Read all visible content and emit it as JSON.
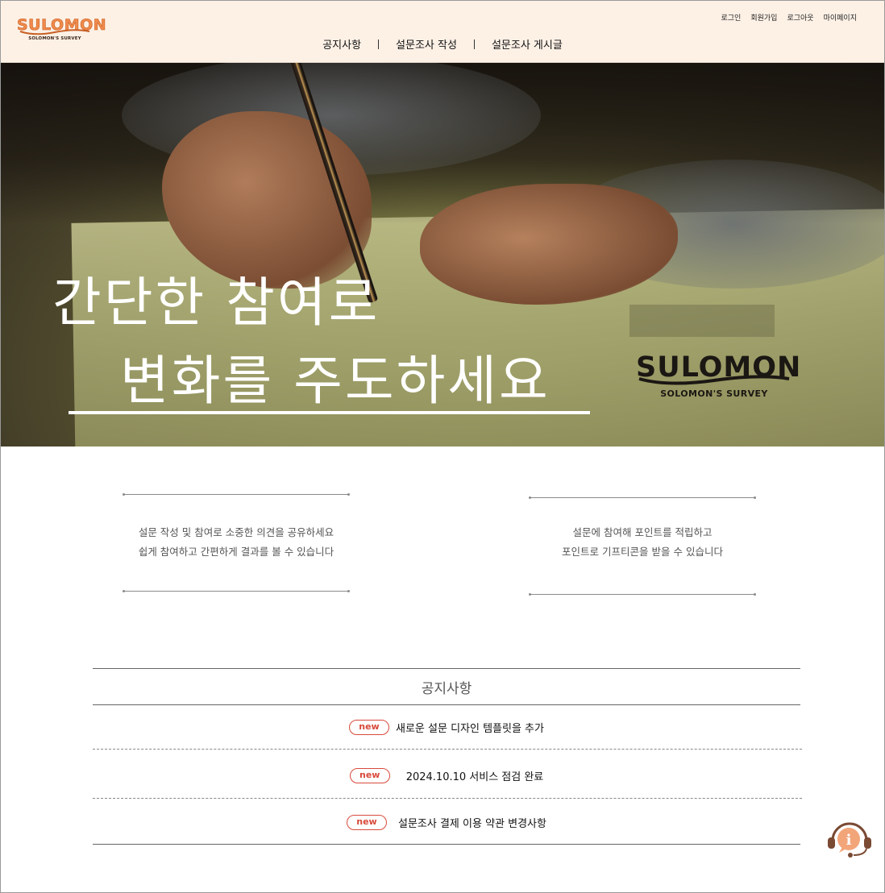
{
  "header": {
    "logo": {
      "word": "SULOMON",
      "sub": "SOLOMON'S SURVEY"
    },
    "util_links": [
      "로그인",
      "회원가입",
      "로그아웃",
      "마이페이지"
    ],
    "nav": [
      "공지사항",
      "설문조사 작성",
      "설문조사 게시글"
    ]
  },
  "hero": {
    "line1": "간단한 참여로",
    "line2": "변화를 주도하세요",
    "logo": {
      "word": "SULOMON",
      "sub": "SOLOMON'S SURVEY"
    }
  },
  "features": [
    {
      "line1": "설문 작성 및 참여로 소중한 의견을 공유하세요",
      "line2": "쉽게 참여하고 간편하게 결과를 볼 수 있습니다"
    },
    {
      "line1": "설문에 참여해 포인트를 적립하고",
      "line2": "포인트로 기프티콘을 받을 수 있습니다"
    }
  ],
  "notice": {
    "title": "공지사항",
    "items": [
      {
        "badge": "new",
        "text": "새로운 설문 디자인 템플릿을 추가"
      },
      {
        "badge": "new",
        "text": "2024.10.10 서비스 점검 완료"
      },
      {
        "badge": "new",
        "text": "설문조사 결제 이용 약관 변경사항"
      }
    ]
  },
  "colors": {
    "header_bg": "#fdf1e6",
    "brand_orange": "#f08a4b",
    "badge_red": "#d84a3b",
    "help_brown": "#7a4a33"
  },
  "help_button": {
    "icon": "help-headset-icon",
    "glyph": "i"
  }
}
